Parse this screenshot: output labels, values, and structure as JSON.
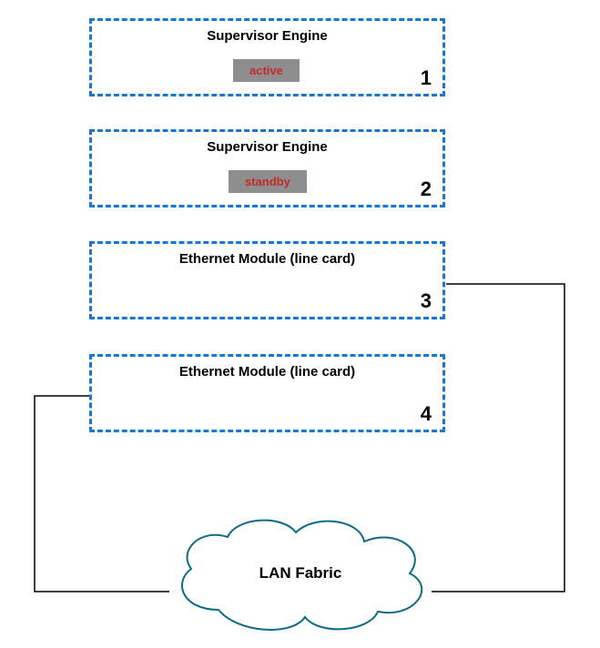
{
  "modules": [
    {
      "title": "Supervisor Engine",
      "state": "active",
      "slot": "1"
    },
    {
      "title": "Supervisor Engine",
      "state": "standby",
      "slot": "2"
    },
    {
      "title": "Ethernet Module (line card)",
      "state": null,
      "slot": "3"
    },
    {
      "title": "Ethernet Module (line card)",
      "state": null,
      "slot": "4"
    }
  ],
  "cloud": {
    "label": "LAN Fabric"
  },
  "colors": {
    "dash_border": "#1976d2",
    "badge_bg": "#8e8e8e",
    "badge_text": "#c62828",
    "cloud_stroke": "#0e6c86"
  }
}
